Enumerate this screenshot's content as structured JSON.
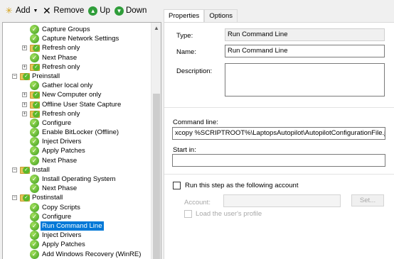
{
  "toolbar": {
    "add_label": "Add",
    "remove_label": "Remove",
    "up_label": "Up",
    "down_label": "Down"
  },
  "tree": {
    "rows": [
      {
        "label": "Capture Groups",
        "indent": 2,
        "kind": "step"
      },
      {
        "label": "Capture Network Settings",
        "indent": 2,
        "kind": "step"
      },
      {
        "label": "Refresh only",
        "indent": 2,
        "kind": "group",
        "expander": "+"
      },
      {
        "label": "Next Phase",
        "indent": 2,
        "kind": "step"
      },
      {
        "label": "Refresh only",
        "indent": 2,
        "kind": "group",
        "expander": "+"
      },
      {
        "label": "Preinstall",
        "indent": 1,
        "kind": "group",
        "expander": "-"
      },
      {
        "label": "Gather local only",
        "indent": 2,
        "kind": "step"
      },
      {
        "label": "New Computer only",
        "indent": 2,
        "kind": "group",
        "expander": "+"
      },
      {
        "label": "Offline User State Capture",
        "indent": 2,
        "kind": "group",
        "expander": "+"
      },
      {
        "label": "Refresh only",
        "indent": 2,
        "kind": "group",
        "expander": "+"
      },
      {
        "label": "Configure",
        "indent": 2,
        "kind": "step"
      },
      {
        "label": "Enable BitLocker (Offline)",
        "indent": 2,
        "kind": "step"
      },
      {
        "label": "Inject Drivers",
        "indent": 2,
        "kind": "step"
      },
      {
        "label": "Apply Patches",
        "indent": 2,
        "kind": "step"
      },
      {
        "label": "Next Phase",
        "indent": 2,
        "kind": "step"
      },
      {
        "label": "Install",
        "indent": 1,
        "kind": "group",
        "expander": "-"
      },
      {
        "label": "Install Operating System",
        "indent": 2,
        "kind": "step"
      },
      {
        "label": "Next Phase",
        "indent": 2,
        "kind": "step"
      },
      {
        "label": "Postinstall",
        "indent": 1,
        "kind": "group",
        "expander": "-"
      },
      {
        "label": "Copy Scripts",
        "indent": 2,
        "kind": "step"
      },
      {
        "label": "Configure",
        "indent": 2,
        "kind": "step"
      },
      {
        "label": "Run Command Line",
        "indent": 2,
        "kind": "step",
        "selected": true
      },
      {
        "label": "Inject Drivers",
        "indent": 2,
        "kind": "step"
      },
      {
        "label": "Apply Patches",
        "indent": 2,
        "kind": "step"
      },
      {
        "label": "Add Windows Recovery (WinRE)",
        "indent": 2,
        "kind": "step"
      }
    ]
  },
  "tabs": [
    {
      "label": "Properties",
      "active": true
    },
    {
      "label": "Options",
      "active": false
    }
  ],
  "properties": {
    "type_label": "Type:",
    "type_value": "Run Command Line",
    "name_label": "Name:",
    "name_value": "Run Command Line",
    "description_label": "Description:",
    "description_value": "",
    "command_line_label": "Command line:",
    "command_line_value": "xcopy %SCRIPTROOT%\\LaptopsAutopilot\\AutopilotConfigurationFile.json %",
    "start_in_label": "Start in:",
    "start_in_value": "",
    "run_as_label": "Run this step as the following account",
    "run_as_checked": false,
    "account_label": "Account:",
    "account_value": "",
    "set_button_label": "Set...",
    "load_profile_label": "Load the user's profile",
    "load_profile_checked": false
  }
}
